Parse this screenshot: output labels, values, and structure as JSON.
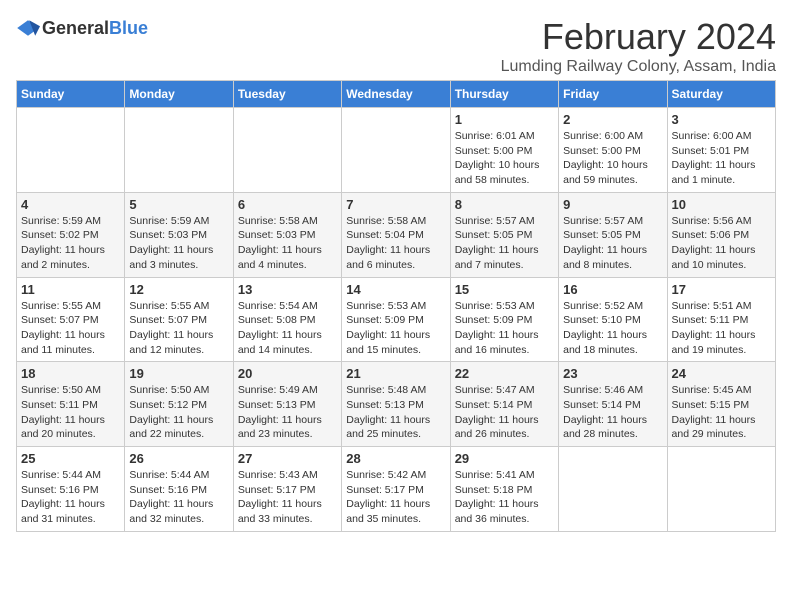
{
  "logo": {
    "general": "General",
    "blue": "Blue"
  },
  "title": "February 2024",
  "subtitle": "Lumding Railway Colony, Assam, India",
  "headers": [
    "Sunday",
    "Monday",
    "Tuesday",
    "Wednesday",
    "Thursday",
    "Friday",
    "Saturday"
  ],
  "weeks": [
    [
      {
        "day": "",
        "info": ""
      },
      {
        "day": "",
        "info": ""
      },
      {
        "day": "",
        "info": ""
      },
      {
        "day": "",
        "info": ""
      },
      {
        "day": "1",
        "info": "Sunrise: 6:01 AM\nSunset: 5:00 PM\nDaylight: 10 hours\nand 58 minutes."
      },
      {
        "day": "2",
        "info": "Sunrise: 6:00 AM\nSunset: 5:00 PM\nDaylight: 10 hours\nand 59 minutes."
      },
      {
        "day": "3",
        "info": "Sunrise: 6:00 AM\nSunset: 5:01 PM\nDaylight: 11 hours\nand 1 minute."
      }
    ],
    [
      {
        "day": "4",
        "info": "Sunrise: 5:59 AM\nSunset: 5:02 PM\nDaylight: 11 hours\nand 2 minutes."
      },
      {
        "day": "5",
        "info": "Sunrise: 5:59 AM\nSunset: 5:03 PM\nDaylight: 11 hours\nand 3 minutes."
      },
      {
        "day": "6",
        "info": "Sunrise: 5:58 AM\nSunset: 5:03 PM\nDaylight: 11 hours\nand 4 minutes."
      },
      {
        "day": "7",
        "info": "Sunrise: 5:58 AM\nSunset: 5:04 PM\nDaylight: 11 hours\nand 6 minutes."
      },
      {
        "day": "8",
        "info": "Sunrise: 5:57 AM\nSunset: 5:05 PM\nDaylight: 11 hours\nand 7 minutes."
      },
      {
        "day": "9",
        "info": "Sunrise: 5:57 AM\nSunset: 5:05 PM\nDaylight: 11 hours\nand 8 minutes."
      },
      {
        "day": "10",
        "info": "Sunrise: 5:56 AM\nSunset: 5:06 PM\nDaylight: 11 hours\nand 10 minutes."
      }
    ],
    [
      {
        "day": "11",
        "info": "Sunrise: 5:55 AM\nSunset: 5:07 PM\nDaylight: 11 hours\nand 11 minutes."
      },
      {
        "day": "12",
        "info": "Sunrise: 5:55 AM\nSunset: 5:07 PM\nDaylight: 11 hours\nand 12 minutes."
      },
      {
        "day": "13",
        "info": "Sunrise: 5:54 AM\nSunset: 5:08 PM\nDaylight: 11 hours\nand 14 minutes."
      },
      {
        "day": "14",
        "info": "Sunrise: 5:53 AM\nSunset: 5:09 PM\nDaylight: 11 hours\nand 15 minutes."
      },
      {
        "day": "15",
        "info": "Sunrise: 5:53 AM\nSunset: 5:09 PM\nDaylight: 11 hours\nand 16 minutes."
      },
      {
        "day": "16",
        "info": "Sunrise: 5:52 AM\nSunset: 5:10 PM\nDaylight: 11 hours\nand 18 minutes."
      },
      {
        "day": "17",
        "info": "Sunrise: 5:51 AM\nSunset: 5:11 PM\nDaylight: 11 hours\nand 19 minutes."
      }
    ],
    [
      {
        "day": "18",
        "info": "Sunrise: 5:50 AM\nSunset: 5:11 PM\nDaylight: 11 hours\nand 20 minutes."
      },
      {
        "day": "19",
        "info": "Sunrise: 5:50 AM\nSunset: 5:12 PM\nDaylight: 11 hours\nand 22 minutes."
      },
      {
        "day": "20",
        "info": "Sunrise: 5:49 AM\nSunset: 5:13 PM\nDaylight: 11 hours\nand 23 minutes."
      },
      {
        "day": "21",
        "info": "Sunrise: 5:48 AM\nSunset: 5:13 PM\nDaylight: 11 hours\nand 25 minutes."
      },
      {
        "day": "22",
        "info": "Sunrise: 5:47 AM\nSunset: 5:14 PM\nDaylight: 11 hours\nand 26 minutes."
      },
      {
        "day": "23",
        "info": "Sunrise: 5:46 AM\nSunset: 5:14 PM\nDaylight: 11 hours\nand 28 minutes."
      },
      {
        "day": "24",
        "info": "Sunrise: 5:45 AM\nSunset: 5:15 PM\nDaylight: 11 hours\nand 29 minutes."
      }
    ],
    [
      {
        "day": "25",
        "info": "Sunrise: 5:44 AM\nSunset: 5:16 PM\nDaylight: 11 hours\nand 31 minutes."
      },
      {
        "day": "26",
        "info": "Sunrise: 5:44 AM\nSunset: 5:16 PM\nDaylight: 11 hours\nand 32 minutes."
      },
      {
        "day": "27",
        "info": "Sunrise: 5:43 AM\nSunset: 5:17 PM\nDaylight: 11 hours\nand 33 minutes."
      },
      {
        "day": "28",
        "info": "Sunrise: 5:42 AM\nSunset: 5:17 PM\nDaylight: 11 hours\nand 35 minutes."
      },
      {
        "day": "29",
        "info": "Sunrise: 5:41 AM\nSunset: 5:18 PM\nDaylight: 11 hours\nand 36 minutes."
      },
      {
        "day": "",
        "info": ""
      },
      {
        "day": "",
        "info": ""
      }
    ]
  ]
}
